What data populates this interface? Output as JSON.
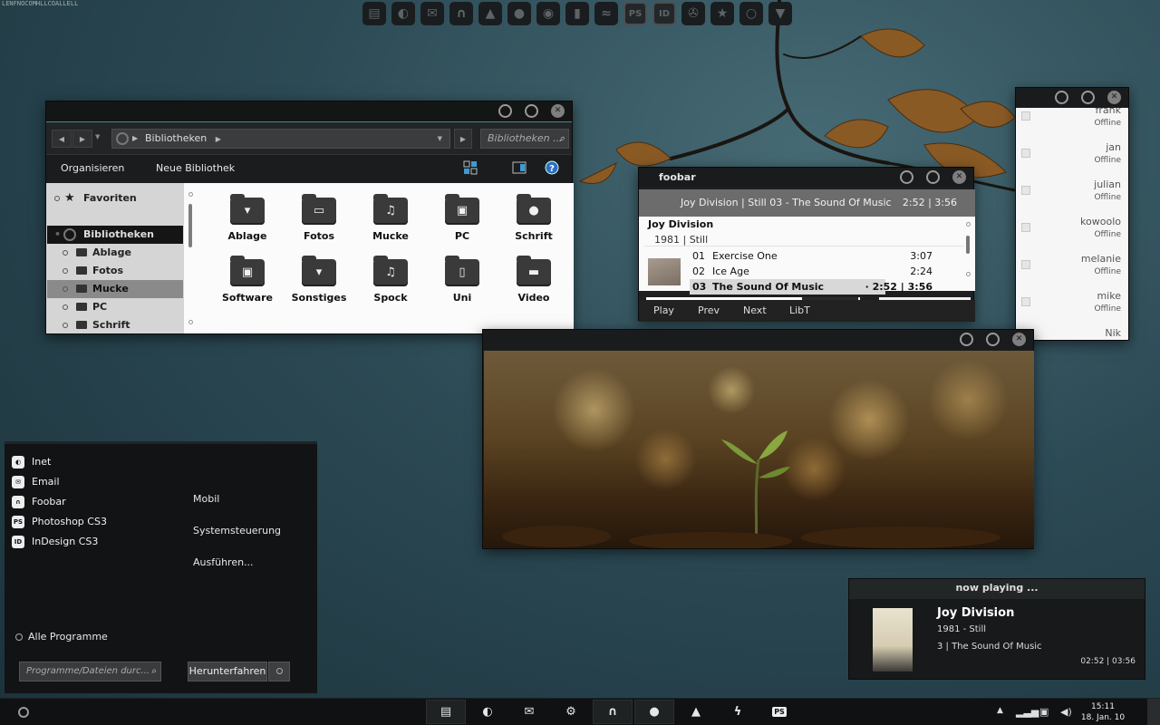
{
  "top_label": "LENFNOCOMHLLCOALLELL",
  "top_dock": [
    {
      "name": "files-icon",
      "glyph": "▤"
    },
    {
      "name": "firefox-icon",
      "glyph": "◐"
    },
    {
      "name": "mail-icon",
      "glyph": "✉"
    },
    {
      "name": "headphones-icon",
      "glyph": "∩"
    },
    {
      "name": "vlc-icon",
      "glyph": "▲"
    },
    {
      "name": "chat-icon",
      "glyph": "●"
    },
    {
      "name": "disc-icon",
      "glyph": "◉"
    },
    {
      "name": "paint-icon",
      "glyph": "▮"
    },
    {
      "name": "wave-icon",
      "glyph": "≈"
    },
    {
      "name": "photoshop-icon",
      "glyph": "PS"
    },
    {
      "name": "indesign-icon",
      "glyph": "ID"
    },
    {
      "name": "aperture-icon",
      "glyph": "✇"
    },
    {
      "name": "star-icon",
      "glyph": "★"
    },
    {
      "name": "circle-icon",
      "glyph": "○"
    },
    {
      "name": "cup-icon",
      "glyph": "▼"
    }
  ],
  "explorer": {
    "address": "Bibliotheken",
    "search_placeholder": "Bibliotheken ...",
    "toolbar": {
      "organize": "Organisieren",
      "new_library": "Neue Bibliothek"
    },
    "nav": {
      "favorites": "Favoriten",
      "libraries": "Bibliotheken",
      "items": [
        "Ablage",
        "Fotos",
        "Mucke",
        "PC",
        "Schrift"
      ]
    },
    "folders": [
      {
        "label": "Ablage",
        "glyph": "▾"
      },
      {
        "label": "Fotos",
        "glyph": "▭"
      },
      {
        "label": "Mucke",
        "glyph": "♫"
      },
      {
        "label": "PC",
        "glyph": "▣"
      },
      {
        "label": "Schrift",
        "glyph": "●"
      },
      {
        "label": "Software",
        "glyph": "▣"
      },
      {
        "label": "Sonstiges",
        "glyph": "▾"
      },
      {
        "label": "Spock",
        "glyph": "♫"
      },
      {
        "label": "Uni",
        "glyph": "▯"
      },
      {
        "label": "Video",
        "glyph": "▬"
      }
    ]
  },
  "foobar": {
    "title": "foobar",
    "now_line": "Joy Division | Still   03 - The Sound Of Music",
    "now_time": "2:52 | 3:56",
    "artist": "Joy Division",
    "album": "1981 | Still",
    "tracks": [
      {
        "num": "01",
        "title": "Exercise One",
        "dur": "3:07"
      },
      {
        "num": "02",
        "title": "Ice Age",
        "dur": "2:24"
      },
      {
        "num": "03",
        "title": "The Sound Of Music",
        "dur": "· 2:52 | 3:56"
      }
    ],
    "controls": [
      "Play",
      "Prev",
      "Next",
      "LibT"
    ]
  },
  "contacts": [
    {
      "name": "frank",
      "status": "Offline"
    },
    {
      "name": "jan",
      "status": "Offline"
    },
    {
      "name": "julian",
      "status": "Offline"
    },
    {
      "name": "kowoolo",
      "status": "Offline"
    },
    {
      "name": "melanie",
      "status": "Offline"
    },
    {
      "name": "mike",
      "status": "Offline"
    },
    {
      "name": "Nik",
      "status": ""
    }
  ],
  "startmenu": {
    "programs": [
      {
        "label": "Inet",
        "icon": "firefox-icon",
        "glyph": "◐"
      },
      {
        "label": "Email",
        "icon": "mail-icon",
        "glyph": "✉"
      },
      {
        "label": "Foobar",
        "icon": "headphones-icon",
        "glyph": "∩"
      },
      {
        "label": "Photoshop CS3",
        "icon": "photoshop-icon",
        "glyph": "PS"
      },
      {
        "label": "InDesign CS3",
        "icon": "indesign-icon",
        "glyph": "ID"
      }
    ],
    "right": [
      "Mobil",
      "Systemsteuerung",
      "Ausführen..."
    ],
    "all_programs": "Alle Programme",
    "search_placeholder": "Programme/Dateien durc...",
    "shutdown": "Herunterfahren"
  },
  "nowplaying": {
    "heading": "now playing ...",
    "artist": "Joy Division",
    "album": "1981 - Still",
    "track": "3 | The Sound Of Music",
    "time": "02:52 | 03:56"
  },
  "taskbar": {
    "tasks": [
      {
        "name": "task-files",
        "glyph": "▤",
        "active": true
      },
      {
        "name": "task-firefox",
        "glyph": "◐",
        "active": false
      },
      {
        "name": "task-mail",
        "glyph": "✉",
        "active": false
      },
      {
        "name": "task-settings",
        "glyph": "⚙",
        "active": false
      },
      {
        "name": "task-foobar",
        "glyph": "∩",
        "active": true
      },
      {
        "name": "task-chat",
        "glyph": "●",
        "active": true
      },
      {
        "name": "task-vlc",
        "glyph": "▲",
        "active": false
      },
      {
        "name": "task-flash",
        "glyph": "ϟ",
        "active": false
      },
      {
        "name": "task-photoshop",
        "glyph": "PS",
        "active": false
      }
    ],
    "time": "15:11",
    "date": "18. Jan. 10"
  }
}
